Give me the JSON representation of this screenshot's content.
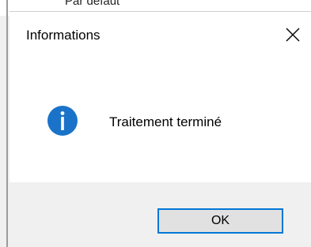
{
  "background_window": {
    "partial_text": "Par défaut"
  },
  "dialog": {
    "title": "Informations",
    "message": "Traitement terminé",
    "icon": "info-icon",
    "ok_label": "OK",
    "close_icon": "close-icon"
  },
  "colors": {
    "icon_blue": "#1a73c9",
    "focus_border": "#0078d7",
    "footer_bg": "#f0f0f0",
    "button_bg": "#e1e1e1"
  }
}
